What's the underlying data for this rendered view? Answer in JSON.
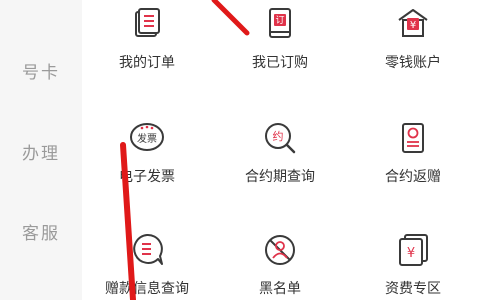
{
  "sidebar": {
    "items": [
      {
        "label": "号卡"
      },
      {
        "label": "办理"
      },
      {
        "label": "客服"
      }
    ]
  },
  "grid": {
    "tiles": [
      {
        "label": "我的订单",
        "icon": "order-list-icon"
      },
      {
        "label": "我已订购",
        "icon": "subscribed-icon",
        "badge": "订"
      },
      {
        "label": "零钱账户",
        "icon": "wallet-house-icon",
        "badge": "¥"
      },
      {
        "label": "电子发票",
        "icon": "invoice-icon",
        "badge": "发票"
      },
      {
        "label": "合约期查询",
        "icon": "contract-search-icon",
        "badge": "约"
      },
      {
        "label": "合约返赠",
        "icon": "contract-gift-icon"
      },
      {
        "label": "赠款信息查询",
        "icon": "gift-info-chat-icon"
      },
      {
        "label": "黑名单",
        "icon": "blacklist-icon"
      },
      {
        "label": "资费专区",
        "icon": "tariff-icon",
        "badge": "¥"
      }
    ]
  },
  "colors": {
    "icon_red": "#e0334a",
    "icon_dark": "#3a3a3a",
    "sidebar_bg": "#f6f6f6",
    "sidebar_text": "#9a9a9a",
    "label_text": "#333333",
    "annotation_red": "#e01919"
  }
}
